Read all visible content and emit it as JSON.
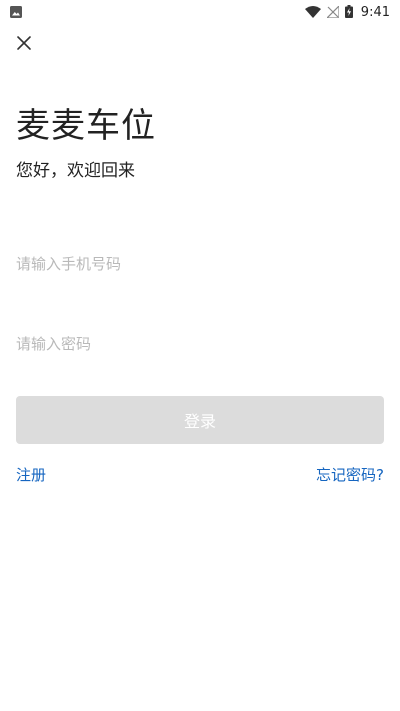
{
  "status_bar": {
    "time": "9:41",
    "icons": [
      "image-icon",
      "wifi-icon",
      "signal-off-icon",
      "battery-charging-icon"
    ]
  },
  "header": {
    "close_icon": "close-icon"
  },
  "main": {
    "app_title": "麦麦车位",
    "welcome": "您好，欢迎回来",
    "phone_placeholder": "请输入手机号码",
    "phone_value": "",
    "password_placeholder": "请输入密码",
    "password_value": "",
    "login_label": "登录",
    "register_label": "注册",
    "forgot_label": "忘记密码?"
  },
  "colors": {
    "link": "#1565c0",
    "button_disabled_bg": "#dcdcdc",
    "button_text": "#ffffff",
    "placeholder": "#b9b9b9",
    "text": "#222222"
  }
}
